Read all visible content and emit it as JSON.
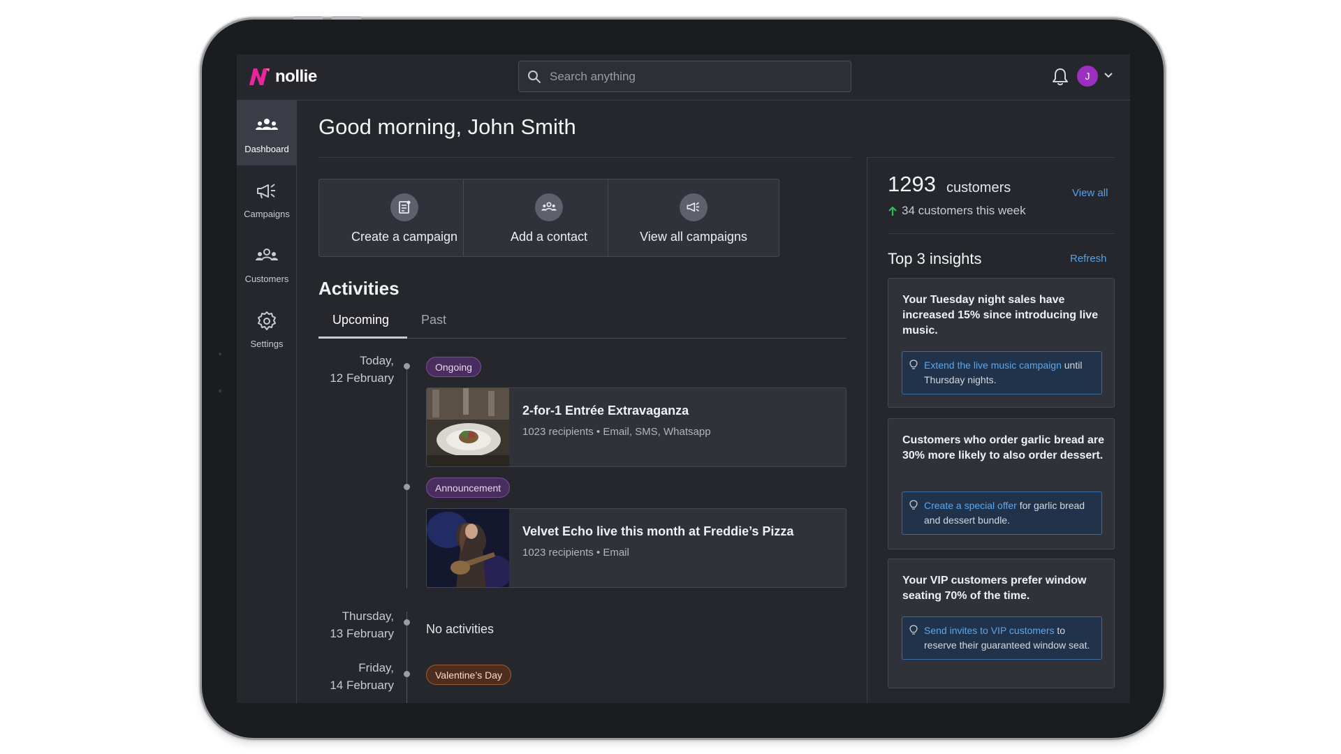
{
  "app": {
    "brand": "nollie"
  },
  "search": {
    "placeholder": "Search anything"
  },
  "user": {
    "initial": "J"
  },
  "sidebar": {
    "items": [
      {
        "label": "Dashboard",
        "icon": "people-icon",
        "active": true
      },
      {
        "label": "Campaigns",
        "icon": "megaphone-icon",
        "active": false
      },
      {
        "label": "Customers",
        "icon": "customers-icon",
        "active": false
      },
      {
        "label": "Settings",
        "icon": "gear-icon",
        "active": false
      }
    ]
  },
  "main": {
    "greeting": "Good morning, John Smith",
    "actions": [
      {
        "label": "Create a campaign",
        "icon": "document-icon"
      },
      {
        "label": "Add a contact",
        "icon": "people-icon"
      },
      {
        "label": "View all campaigns",
        "icon": "megaphone-icon"
      }
    ],
    "activities": {
      "title": "Activities",
      "tabs": [
        {
          "label": "Upcoming",
          "active": true
        },
        {
          "label": "Past",
          "active": false
        }
      ],
      "days": [
        {
          "date_line1": "Today,",
          "date_line2": "12 February"
        },
        {
          "date_line1": "Thursday,",
          "date_line2": "13 February"
        },
        {
          "date_line1": "Friday,",
          "date_line2": "14 February"
        }
      ],
      "events": [
        {
          "tag": "Ongoing",
          "title": "2-for-1 Entrée Extravaganza",
          "subtitle": "1023 recipients • Email, SMS, Whatsapp"
        },
        {
          "tag": "Announcement",
          "title": "Velvet Echo live this month at Freddie’s Pizza",
          "subtitle": "1023 recipients • Email"
        }
      ],
      "no_activities": "No activities",
      "friday_tag": "Valentine’s Day"
    }
  },
  "stats": {
    "customers_count": "1293",
    "customers_word": "customers",
    "view_all": "View all",
    "customers_week": "34 customers this week"
  },
  "insights": {
    "title": "Top 3 insights",
    "refresh": "Refresh",
    "items": [
      {
        "text": "Your Tuesday night sales have increased 15% since introducing live music.",
        "link": "Extend the live music campaign",
        "rest": "until Thursday nights."
      },
      {
        "text": "Customers who order garlic bread are 30% more likely to also order dessert.",
        "link": "Create a special offer",
        "rest": "for garlic bread and dessert bundle."
      },
      {
        "text": "Your VIP customers prefer window seating 70% of the time.",
        "link": "Send invites to VIP customers",
        "rest": "to reserve their guaranteed window seat."
      }
    ]
  },
  "colors": {
    "accent_brand": "#e6269a",
    "link": "#5aa0e6",
    "success": "#2fb85f",
    "avatar": "#9b2fbf"
  }
}
